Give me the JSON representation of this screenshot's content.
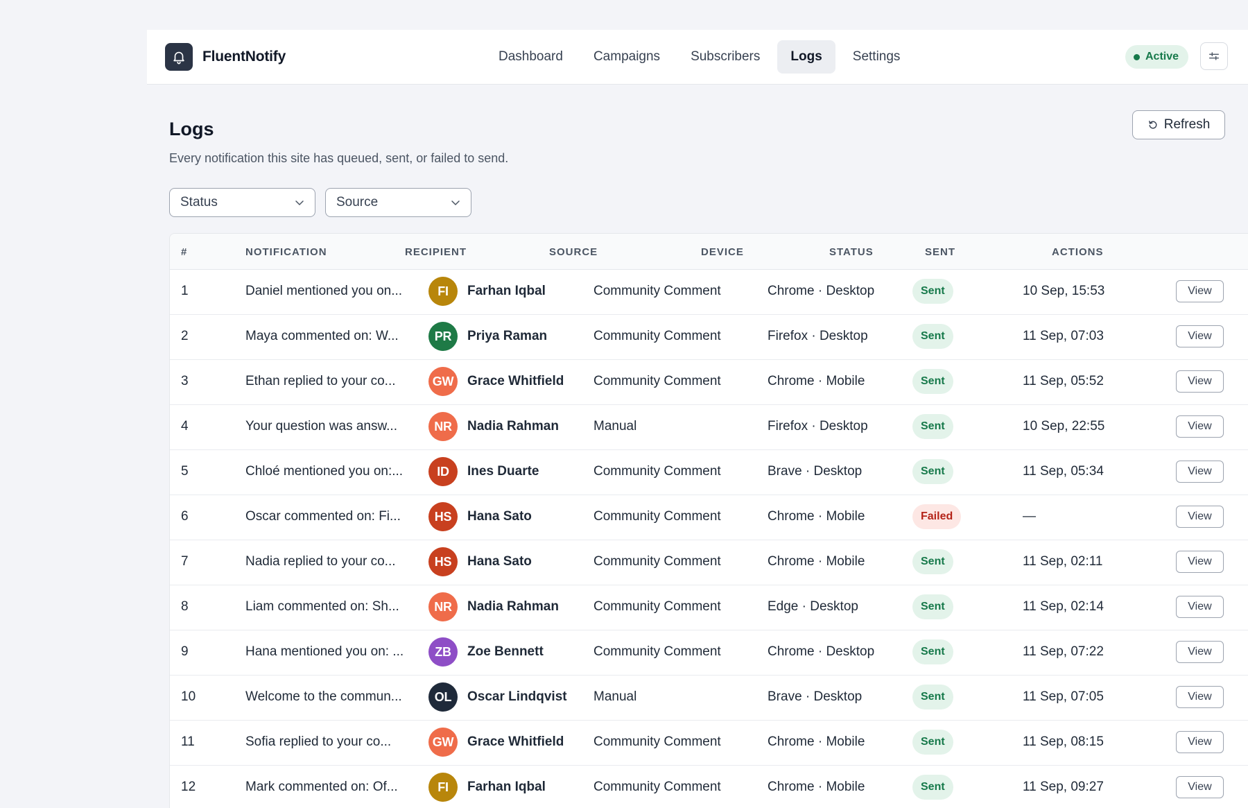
{
  "app": {
    "name": "FluentNotify",
    "logo_icon": "bell-icon"
  },
  "nav": {
    "items": [
      {
        "label": "Dashboard",
        "active": false
      },
      {
        "label": "Campaigns",
        "active": false
      },
      {
        "label": "Subscribers",
        "active": false
      },
      {
        "label": "Logs",
        "active": true
      },
      {
        "label": "Settings",
        "active": false
      }
    ]
  },
  "header": {
    "status_label": "Active",
    "status_color": "#16794a",
    "settings_icon": "sliders-icon"
  },
  "page": {
    "title": "Logs",
    "subtitle": "Every notification this site has queued, sent, or failed to send.",
    "refresh_label": "Refresh"
  },
  "filters": {
    "status_placeholder": "Status",
    "source_placeholder": "Source"
  },
  "table": {
    "columns": [
      "#",
      "Notification",
      "Recipient",
      "Source",
      "Device",
      "Status",
      "Sent",
      "Actions"
    ],
    "view_label": "View",
    "rows": [
      {
        "num": "1",
        "notification": "Daniel mentioned you on...",
        "initials": "FI",
        "avatar_color": "#b8860b",
        "recipient": "Farhan Iqbal",
        "source": "Community Comment",
        "device": "Chrome · Desktop",
        "status": "Sent",
        "sent": "10 Sep, 15:53"
      },
      {
        "num": "2",
        "notification": "Maya commented on: W...",
        "initials": "PR",
        "avatar_color": "#1e7a46",
        "recipient": "Priya Raman",
        "source": "Community Comment",
        "device": "Firefox · Desktop",
        "status": "Sent",
        "sent": "11 Sep, 07:03"
      },
      {
        "num": "3",
        "notification": "Ethan replied to your co...",
        "initials": "GW",
        "avatar_color": "#ef6c4a",
        "recipient": "Grace Whitfield",
        "source": "Community Comment",
        "device": "Chrome · Mobile",
        "status": "Sent",
        "sent": "11 Sep, 05:52"
      },
      {
        "num": "4",
        "notification": "Your question was answ...",
        "initials": "NR",
        "avatar_color": "#ef6c4a",
        "recipient": "Nadia Rahman",
        "source": "Manual",
        "device": "Firefox · Desktop",
        "status": "Sent",
        "sent": "10 Sep, 22:55"
      },
      {
        "num": "5",
        "notification": "Chloé mentioned you on:...",
        "initials": "ID",
        "avatar_color": "#c8401f",
        "recipient": "Ines Duarte",
        "source": "Community Comment",
        "device": "Brave · Desktop",
        "status": "Sent",
        "sent": "11 Sep, 05:34"
      },
      {
        "num": "6",
        "notification": "Oscar commented on: Fi...",
        "initials": "HS",
        "avatar_color": "#c8401f",
        "recipient": "Hana Sato",
        "source": "Community Comment",
        "device": "Chrome · Mobile",
        "status": "Failed",
        "sent": "—"
      },
      {
        "num": "7",
        "notification": "Nadia replied to your co...",
        "initials": "HS",
        "avatar_color": "#c8401f",
        "recipient": "Hana Sato",
        "source": "Community Comment",
        "device": "Chrome · Mobile",
        "status": "Sent",
        "sent": "11 Sep, 02:11"
      },
      {
        "num": "8",
        "notification": "Liam commented on: Sh...",
        "initials": "NR",
        "avatar_color": "#ef6c4a",
        "recipient": "Nadia Rahman",
        "source": "Community Comment",
        "device": "Edge · Desktop",
        "status": "Sent",
        "sent": "11 Sep, 02:14"
      },
      {
        "num": "9",
        "notification": "Hana mentioned you on: ...",
        "initials": "ZB",
        "avatar_color": "#8e4ec6",
        "recipient": "Zoe Bennett",
        "source": "Community Comment",
        "device": "Chrome · Desktop",
        "status": "Sent",
        "sent": "11 Sep, 07:22"
      },
      {
        "num": "10",
        "notification": "Welcome to the commun...",
        "initials": "OL",
        "avatar_color": "#1f2a3a",
        "recipient": "Oscar Lindqvist",
        "source": "Manual",
        "device": "Brave · Desktop",
        "status": "Sent",
        "sent": "11 Sep, 07:05"
      },
      {
        "num": "11",
        "notification": "Sofia replied to your co...",
        "initials": "GW",
        "avatar_color": "#ef6c4a",
        "recipient": "Grace Whitfield",
        "source": "Community Comment",
        "device": "Chrome · Mobile",
        "status": "Sent",
        "sent": "11 Sep, 08:15"
      },
      {
        "num": "12",
        "notification": "Mark commented on: Of...",
        "initials": "FI",
        "avatar_color": "#b8860b",
        "recipient": "Farhan Iqbal",
        "source": "Community Comment",
        "device": "Chrome · Mobile",
        "status": "Sent",
        "sent": "11 Sep, 09:27"
      }
    ]
  }
}
